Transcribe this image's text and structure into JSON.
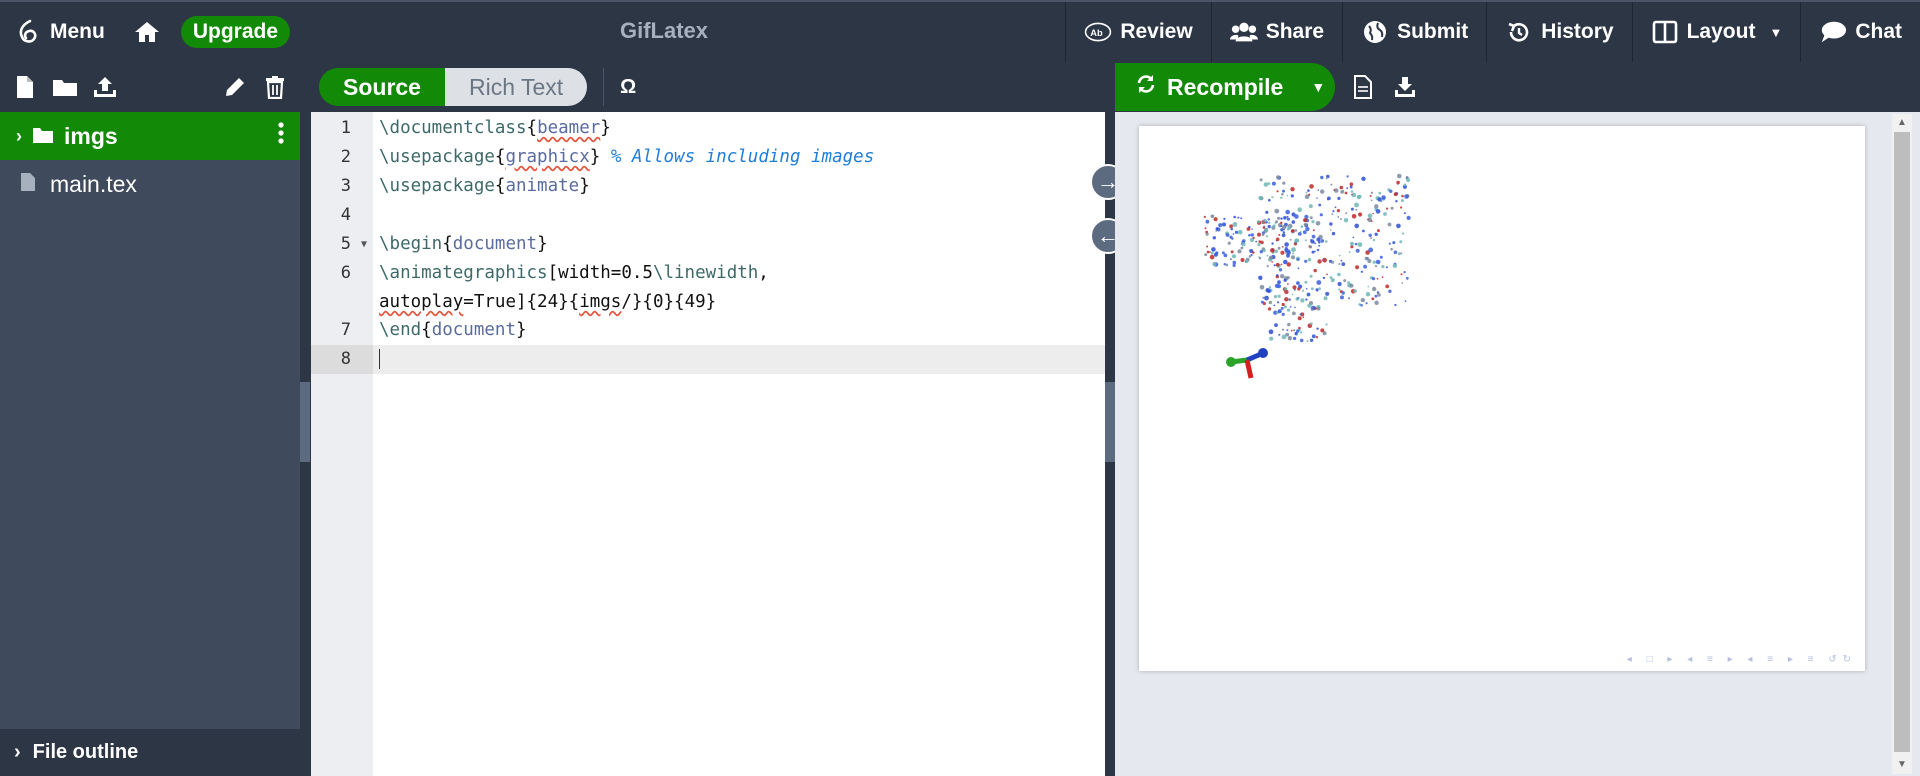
{
  "topbar": {
    "menu_label": "Menu",
    "upgrade_label": "Upgrade",
    "project_title": "GifLatex",
    "review_label": "Review",
    "share_label": "Share",
    "submit_label": "Submit",
    "history_label": "History",
    "layout_label": "Layout",
    "chat_label": "Chat"
  },
  "sidebar": {
    "folder": {
      "name": "imgs",
      "icon": "folder-icon"
    },
    "files": [
      {
        "name": "main.tex",
        "icon": "file-icon"
      }
    ],
    "outline_label": "File outline"
  },
  "editor": {
    "mode_source": "Source",
    "mode_richtext": "Rich Text",
    "symbol_label": "Ω",
    "line_numbers": [
      "1",
      "2",
      "3",
      "4",
      "5",
      "6",
      "7",
      "8"
    ],
    "lines": {
      "l1_cmd": "\\documentclass",
      "l1_arg": "beamer",
      "l2_cmd": "\\usepackage",
      "l2_arg": "graphicx",
      "l2_comment": "% Allows including images",
      "l3_cmd": "\\usepackage",
      "l3_arg": "animate",
      "l5_cmd": "\\begin",
      "l5_arg": "document",
      "l6_cmd": "\\animategraphics",
      "l6_opt1": "[width=0.5",
      "l6_cmd2": "\\linewidth",
      "l6_opt2": ",",
      "l6_wrap_a": "autoplay",
      "l6_wrap_b": "=True]{24}{",
      "l6_wrap_c": "imgs",
      "l6_wrap_d": "/}{0}{49}",
      "l7_cmd": "\\end",
      "l7_arg": "document"
    }
  },
  "pdf": {
    "recompile_label": "Recompile"
  },
  "colors": {
    "accent_green": "#138a07",
    "dark_bg": "#2c3645",
    "sidebar_bg": "#3f4a5c"
  }
}
